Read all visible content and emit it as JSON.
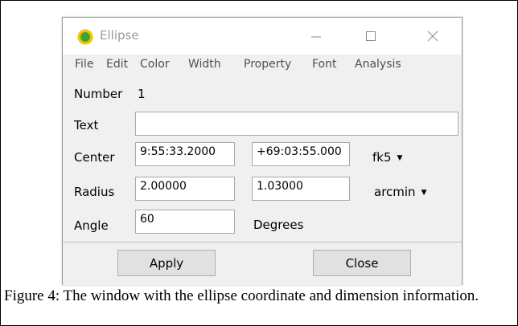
{
  "window": {
    "title": "Ellipse",
    "controls": {
      "minimize": "minimize-icon",
      "maximize": "maximize-icon",
      "close": "close-icon"
    }
  },
  "menu": [
    "File",
    "Edit",
    "Color",
    "Width",
    "Property",
    "Font",
    "Analysis"
  ],
  "form": {
    "number_label": "Number",
    "number_value": "1",
    "text_label": "Text",
    "text_value": "",
    "center_label": "Center",
    "center_ra": "9:55:33.2000",
    "center_dec": "+69:03:55.000",
    "center_system": "fk5",
    "radius_label": "Radius",
    "radius_major": "2.00000",
    "radius_minor": "1.03000",
    "radius_unit": "arcmin",
    "angle_label": "Angle",
    "angle_value": "60",
    "angle_unit": "Degrees"
  },
  "buttons": {
    "apply": "Apply",
    "close": "Close"
  },
  "caption": "Figure 4: The window with the ellipse coordinate and dimension information.",
  "colors": {
    "app_icon_outer": "#f5c400",
    "app_icon_inner": "#3aa735"
  }
}
